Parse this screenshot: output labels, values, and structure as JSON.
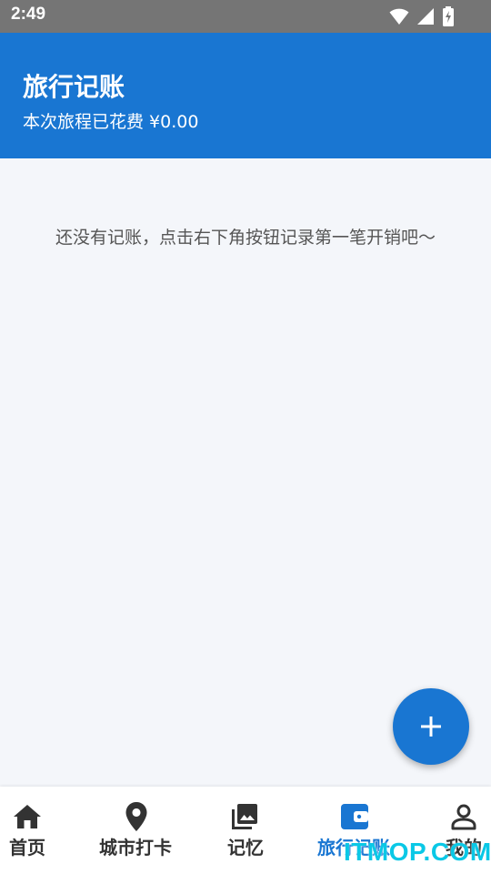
{
  "status_bar": {
    "time": "2:49",
    "icons": [
      "wifi-icon",
      "signal-icon",
      "battery-charging-icon"
    ]
  },
  "header": {
    "title": "旅行记账",
    "subtitle": "本次旅程已花费 ¥0.00"
  },
  "main": {
    "empty_message": "还没有记账，点击右下角按钮记录第一笔开销吧～"
  },
  "fab": {
    "icon": "plus-icon"
  },
  "bottom_nav": {
    "items": [
      {
        "label": "首页",
        "icon": "home-icon",
        "active": false
      },
      {
        "label": "城市打卡",
        "icon": "location-pin-icon",
        "active": false
      },
      {
        "label": "记忆",
        "icon": "photo-library-icon",
        "active": false
      },
      {
        "label": "旅行记账",
        "icon": "wallet-icon",
        "active": true
      },
      {
        "label": "我的",
        "icon": "person-icon",
        "active": false
      }
    ]
  },
  "watermark": {
    "text": "ITMOP.COM"
  },
  "colors": {
    "primary": "#1976d2",
    "status_bar": "#757575",
    "background": "#f4f6fa",
    "nav_inactive": "#333333",
    "watermark": "#0ac8e6"
  }
}
